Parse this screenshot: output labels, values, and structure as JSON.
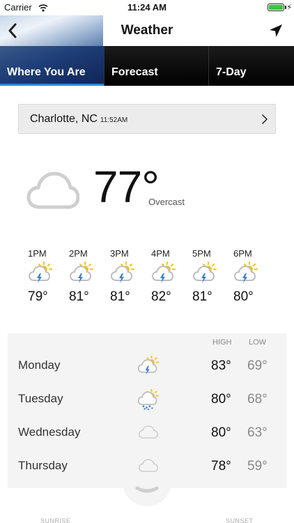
{
  "status_bar": {
    "carrier": "Carrier",
    "time": "11:24 AM",
    "battery_percent": 100
  },
  "header": {
    "title": "Weather",
    "back_icon": "chevron-left-icon",
    "location_icon": "location-arrow-icon"
  },
  "tabs": [
    {
      "label": "Where You Are",
      "active": true
    },
    {
      "label": "Forecast",
      "active": false
    },
    {
      "label": "7-Day",
      "active": false
    }
  ],
  "location": {
    "city": "Charlotte, NC",
    "time": "11:52AM"
  },
  "current": {
    "temp": "77°",
    "condition": "Overcast",
    "icon": "cloud-icon"
  },
  "hourly": [
    {
      "time": "1PM",
      "temp": "79°",
      "icon": "thunderstorm-sun-icon"
    },
    {
      "time": "2PM",
      "temp": "81°",
      "icon": "thunderstorm-sun-icon"
    },
    {
      "time": "3PM",
      "temp": "81°",
      "icon": "thunderstorm-sun-icon"
    },
    {
      "time": "4PM",
      "temp": "82°",
      "icon": "thunderstorm-sun-icon"
    },
    {
      "time": "5PM",
      "temp": "81°",
      "icon": "thunderstorm-sun-icon"
    },
    {
      "time": "6PM",
      "temp": "80°",
      "icon": "thunderstorm-sun-icon"
    }
  ],
  "daily": {
    "high_label": "HIGH",
    "low_label": "LOW",
    "days": [
      {
        "name": "Monday",
        "high": "83°",
        "low": "69°",
        "icon": "thunderstorm-sun-icon"
      },
      {
        "name": "Tuesday",
        "high": "80°",
        "low": "68°",
        "icon": "rain-sun-icon"
      },
      {
        "name": "Wednesday",
        "high": "80°",
        "low": "63°",
        "icon": "cloud-icon"
      },
      {
        "name": "Thursday",
        "high": "78°",
        "low": "59°",
        "icon": "cloud-icon"
      }
    ]
  },
  "footer": {
    "sunrise_label": "SUNRISE",
    "sunset_label": "SUNSET"
  },
  "colors": {
    "tab_active_underline": "#2b8bd6",
    "sun": "#f5c518",
    "bolt": "#3a7fd8"
  }
}
